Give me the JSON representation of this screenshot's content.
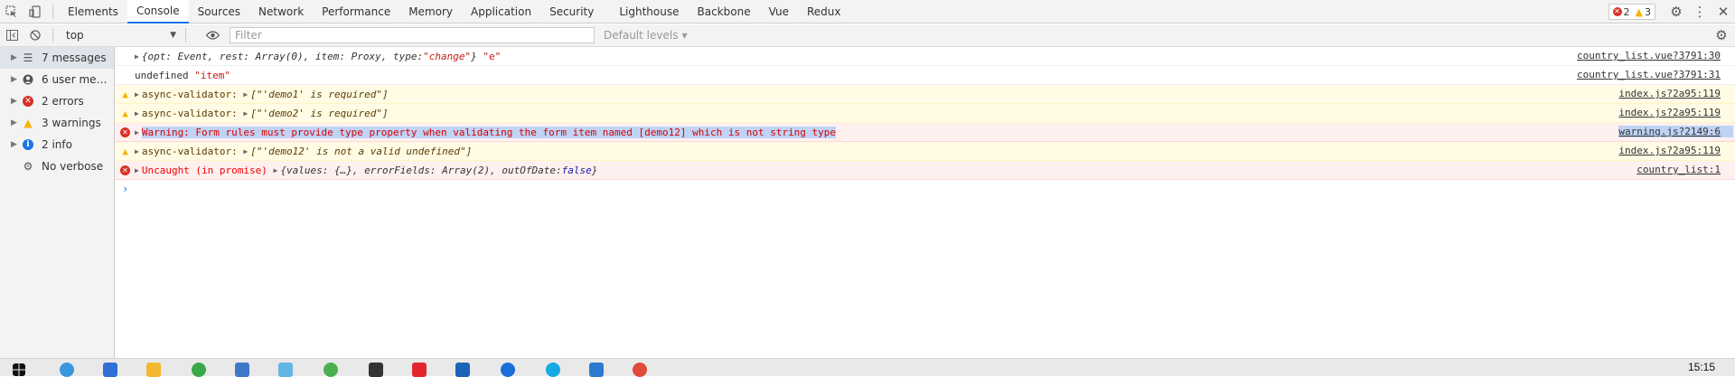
{
  "tabs": [
    "Elements",
    "Console",
    "Sources",
    "Network",
    "Performance",
    "Memory",
    "Application",
    "Security",
    "Lighthouse",
    "Backbone",
    "Vue",
    "Redux"
  ],
  "active_tab": "Console",
  "badges": {
    "errors": "2",
    "warnings": "3"
  },
  "toolbar": {
    "context": "top",
    "filter_placeholder": "Filter",
    "levels": "Default levels"
  },
  "sidebar": [
    {
      "label": "7 messages",
      "icon": "list-icon"
    },
    {
      "label": "6 user mess…",
      "icon": "user-icon"
    },
    {
      "label": "2 errors",
      "icon": "error-icon"
    },
    {
      "label": "3 warnings",
      "icon": "warning-icon"
    },
    {
      "label": "2 info",
      "icon": "info-icon"
    },
    {
      "label": "No verbose",
      "icon": "verbose-icon"
    }
  ],
  "console": {
    "m1": {
      "p1": "{opt: Event, rest: Array(0), item: Proxy, type: ",
      "p2": "\"change\"",
      "p3": "} ",
      "p4": "\"e\"",
      "src": "country_list.vue?3791:30"
    },
    "m2": {
      "p1": "undefined ",
      "p2": "\"item\"",
      "src": "country_list.vue?3791:31"
    },
    "m3": {
      "p1": "async-validator: ",
      "p2": "[\"'demo1' is required\"]",
      "src": "index.js?2a95:119"
    },
    "m4": {
      "p1": "async-validator: ",
      "p2": "[\"'demo2' is required\"]",
      "src": "index.js?2a95:119"
    },
    "m5": {
      "text": "Warning: Form rules must provide type property when validating the form item named [demo12] which is not string type",
      "src": "warning.js?2149:6"
    },
    "m6": {
      "p1": "async-validator: ",
      "p2": "[\"'demo12' is not a valid undefined\"]",
      "src": "index.js?2a95:119"
    },
    "m7": {
      "p1": "Uncaught (in promise) ",
      "p2": "{values: {…}, errorFields: Array(2), outOfDate: ",
      "p3": "false",
      "p4": "}",
      "src": "country_list:1"
    }
  },
  "clock": "15:15"
}
